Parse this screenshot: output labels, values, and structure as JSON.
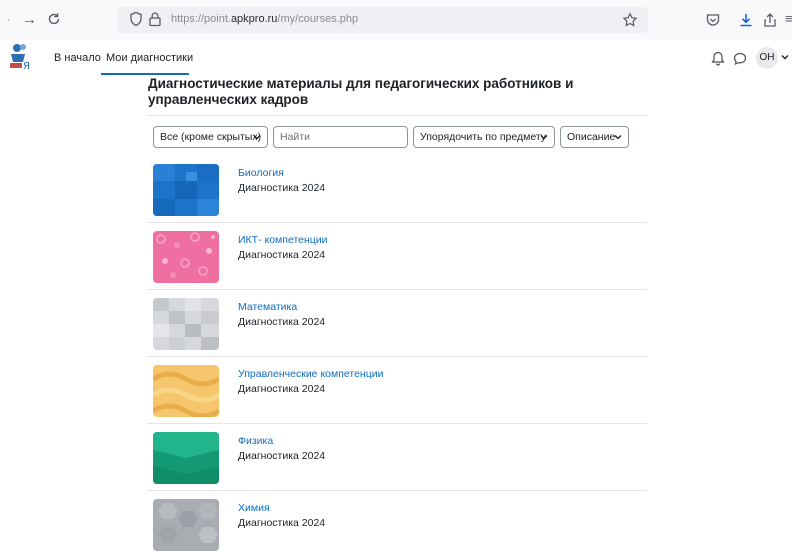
{
  "browser": {
    "url_prefix": "https://point.",
    "url_domain": "apkpro.ru",
    "url_path": "/my/courses.php",
    "back_icon": "back-arrow-icon",
    "forward_icon": "forward-arrow-icon",
    "reload_icon": "reload-icon"
  },
  "navbar": {
    "home_label": "В начало",
    "mycourses_label": "Мои диагностики",
    "avatar_initials": "ОН",
    "active_color": "#0f6cbf"
  },
  "page": {
    "title": "Диагностические материалы для педагогических работников и управленческих кадров"
  },
  "filters": {
    "grouping": "Все (кроме скрытых)",
    "search_placeholder": "Найти",
    "sort": "Упорядочить по предмету",
    "view": "Описание"
  },
  "courses": [
    {
      "name": "Биология",
      "category": "Диагностика 2024"
    },
    {
      "name": "ИКТ- компетенции",
      "category": "Диагностика 2024"
    },
    {
      "name": "Математика",
      "category": "Диагностика 2024"
    },
    {
      "name": "Управленческие компетенции",
      "category": "Диагностика 2024"
    },
    {
      "name": "Физика",
      "category": "Диагностика 2024"
    },
    {
      "name": "Химия",
      "category": "Диагностика 2024"
    }
  ]
}
